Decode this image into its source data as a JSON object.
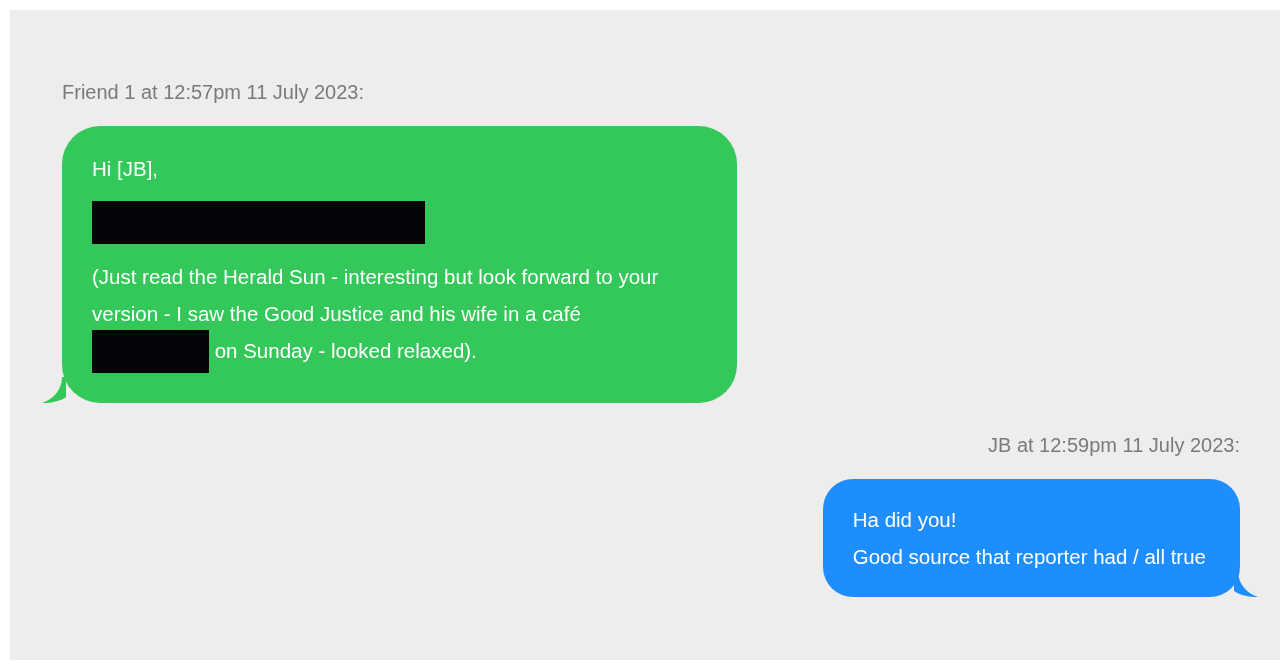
{
  "messages": [
    {
      "kind": "received",
      "meta": "Friend 1 at 12:57pm 11 July 2023:",
      "paragraphs": [
        [
          {
            "kind": "text",
            "text": "Hi [JB],"
          }
        ],
        [
          {
            "kind": "redacted-line"
          }
        ],
        [
          {
            "kind": "text",
            "text": "(Just read the Herald Sun - interesting but look forward to your version - I saw the Good Justice and his wife in a café "
          },
          {
            "kind": "redacted-word"
          },
          {
            "kind": "text",
            "text": " on Sunday - looked relaxed)."
          }
        ]
      ]
    },
    {
      "kind": "sent",
      "meta": "JB at 12:59pm 11 July 2023:",
      "paragraphs": [
        [
          {
            "kind": "text",
            "text": "Ha did you!"
          }
        ],
        [
          {
            "kind": "text",
            "text": "Good source that reporter had / all true"
          }
        ]
      ]
    }
  ]
}
